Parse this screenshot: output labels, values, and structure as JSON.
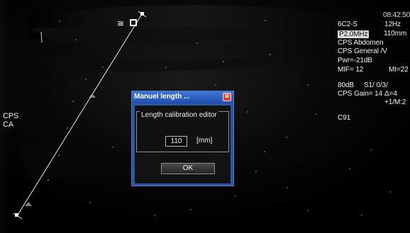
{
  "ui": {
    "left_labels": [
      "CPS",
      "CA"
    ],
    "top_icon": {
      "symbol": "≅",
      "box_icon": "square-outline-icon"
    },
    "status": {
      "time": "08:42:50",
      "probe": "6C2-S",
      "frame_rate": "12Hz",
      "frequency": "P2.0MHz",
      "depth": "110mm",
      "preset_1": "CPS Abdomen",
      "preset_2": "CPS General /V",
      "power": "Pwr=-21dB",
      "mif": "MIF= 12",
      "mi": "MI=22",
      "gain_db": "80dB",
      "s1": "S1/ 0/3/",
      "cps_gain": "CPS Gain= 14",
      "delta": "Δ=4",
      "ratio": "+1/M:2",
      "c91": "C91"
    },
    "dialog": {
      "title": "Manuel length ...",
      "close_icon": "close-icon",
      "group_label": "Length calibration editor",
      "input_value": "110",
      "unit": "[mm]",
      "ok_label": "OK"
    }
  },
  "colors": {
    "background": "#000000",
    "dialog_blue": "#2d56a8",
    "title_blue": "#3f76d8",
    "close_red": "#d94630",
    "measurement_line": "#f2eadf",
    "text": "#f0f0f0"
  }
}
